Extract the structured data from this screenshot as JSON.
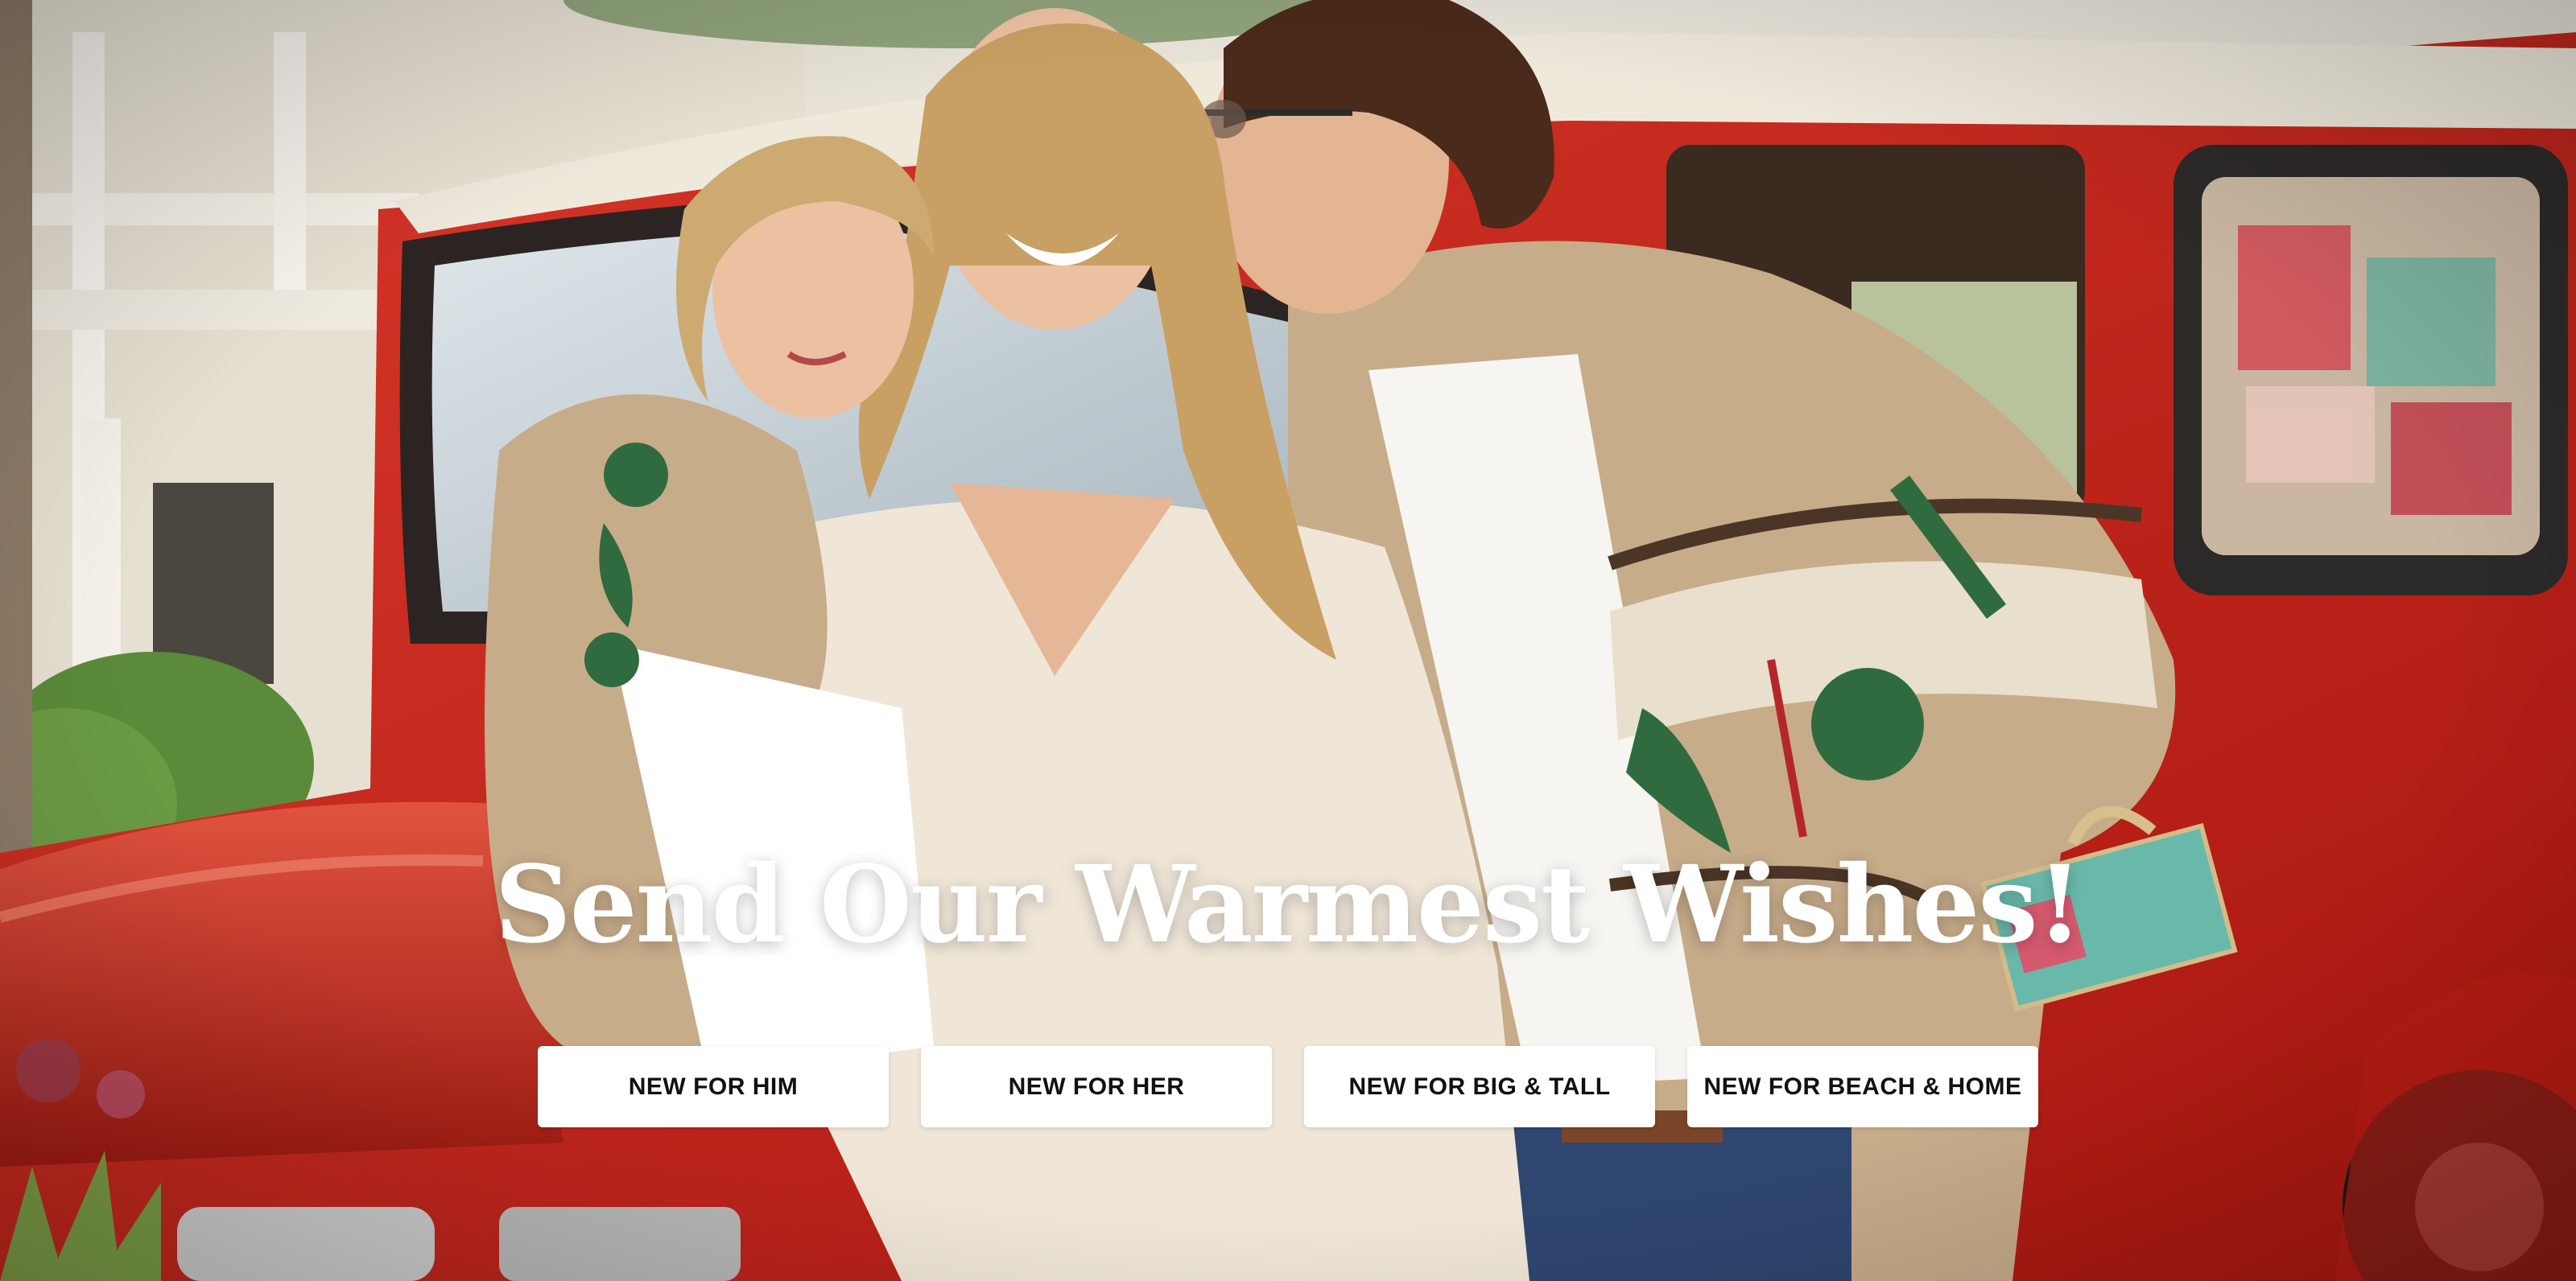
{
  "hero": {
    "headline": "Send Our Warmest Wishes!",
    "buttons": [
      {
        "label": "NEW FOR HIM"
      },
      {
        "label": "NEW FOR HER"
      },
      {
        "label": "NEW FOR BIG & TALL"
      },
      {
        "label": "NEW FOR BEACH & HOME"
      }
    ]
  },
  "colors": {
    "truck_red": "#c2241c",
    "truck_roof": "#efe9dc",
    "sweater_tan": "#c7ac8a",
    "sweater_cream": "#efe6d8",
    "button_bg": "#ffffff",
    "button_text": "#111111",
    "headline_text": "#ffffff"
  }
}
